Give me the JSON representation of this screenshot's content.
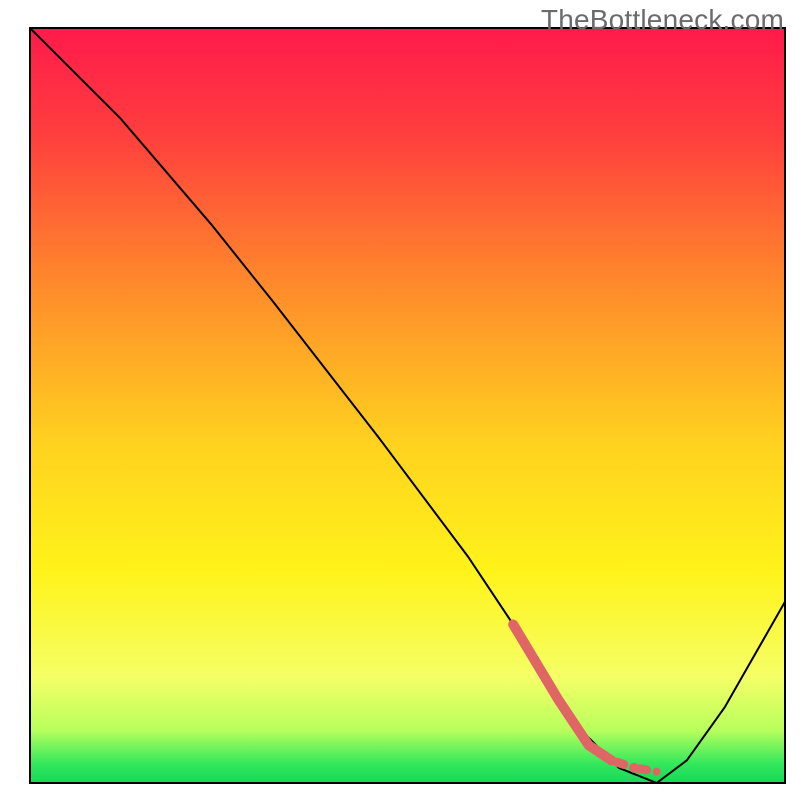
{
  "watermark": "TheBottleneck.com",
  "chart_data": {
    "type": "line",
    "notes": "Bottleneck-style curve over a vertical red→yellow→green gradient, framed. X-axis is implied resolution/quality (0..100), Y-axis is bottleneck percentage (0..100). A salmon dashed segment marks the recommended zone near the valley.",
    "xlim": [
      0,
      100
    ],
    "ylim": [
      0,
      100
    ],
    "xlabel": "",
    "ylabel": "",
    "title": "",
    "grid": false,
    "gradient_stops": [
      {
        "offset": 0.0,
        "color": "#ff1a4b"
      },
      {
        "offset": 0.14,
        "color": "#ff3e3e"
      },
      {
        "offset": 0.34,
        "color": "#ff8a2b"
      },
      {
        "offset": 0.55,
        "color": "#ffd21f"
      },
      {
        "offset": 0.72,
        "color": "#fff31a"
      },
      {
        "offset": 0.86,
        "color": "#f5ff66"
      },
      {
        "offset": 0.93,
        "color": "#b8ff5c"
      },
      {
        "offset": 0.975,
        "color": "#32e85c"
      },
      {
        "offset": 1.0,
        "color": "#15d85a"
      }
    ],
    "series": [
      {
        "name": "bottleneck_curve",
        "stroke": "#000000",
        "stroke_width": 2,
        "points": [
          {
            "x": 0,
            "y": 100
          },
          {
            "x": 12,
            "y": 88
          },
          {
            "x": 24,
            "y": 74
          },
          {
            "x": 32,
            "y": 64
          },
          {
            "x": 46,
            "y": 46
          },
          {
            "x": 58,
            "y": 30
          },
          {
            "x": 66,
            "y": 18
          },
          {
            "x": 72,
            "y": 8
          },
          {
            "x": 78,
            "y": 2
          },
          {
            "x": 83,
            "y": 0
          },
          {
            "x": 87,
            "y": 3
          },
          {
            "x": 92,
            "y": 10
          },
          {
            "x": 96,
            "y": 17
          },
          {
            "x": 100,
            "y": 24
          }
        ]
      },
      {
        "name": "recommended_zone_marker",
        "stroke": "#e06666",
        "stroke_width": 10,
        "style": "dashed-then-solid",
        "points": [
          {
            "x": 64,
            "y": 21
          },
          {
            "x": 70,
            "y": 11
          },
          {
            "x": 74,
            "y": 5
          },
          {
            "x": 77,
            "y": 3
          },
          {
            "x": 80,
            "y": 2
          },
          {
            "x": 83,
            "y": 1.5
          }
        ]
      }
    ],
    "frame": {
      "stroke": "#000000",
      "stroke_width": 2
    }
  }
}
